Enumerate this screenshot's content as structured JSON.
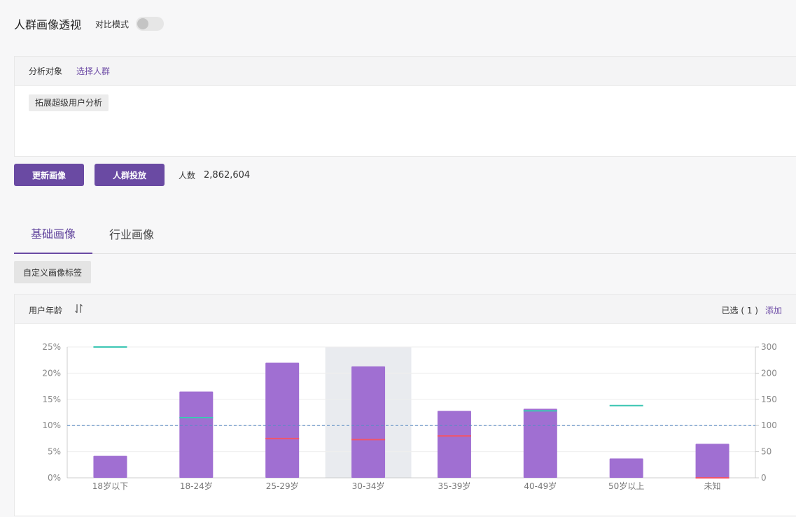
{
  "header": {
    "title": "人群画像透视",
    "compare_mode_label": "对比模式"
  },
  "target": {
    "label": "分析对象",
    "select_link": "选择人群",
    "selected_tag": "拓展超级用户分析"
  },
  "actions": {
    "update_label": "更新画像",
    "deliver_label": "人群投放",
    "count_label": "人数",
    "count_value": "2,862,604"
  },
  "tabs": [
    {
      "label": "基础画像",
      "active": true
    },
    {
      "label": "行业画像",
      "active": false
    }
  ],
  "custom_tags_label": "自定义画像标签",
  "panel": {
    "attribute_label": "用户年龄",
    "selected_label": "已选 ( 1 )",
    "add_label": "添加"
  },
  "colors": {
    "accent": "#6a4aa3",
    "bar": "#a06fd2",
    "tgi_line": "#3cc6b3",
    "compare_line": "#f0546a",
    "reference_line": "#5b8cc4",
    "highlight": "#e9ebef"
  },
  "chart_data": {
    "type": "bar",
    "categories": [
      "18岁以下",
      "18-24岁",
      "25-29岁",
      "30-34岁",
      "35-39岁",
      "40-49岁",
      "50岁以上",
      "未知"
    ],
    "series": [
      {
        "values": [
          4.2,
          16.5,
          22.0,
          21.3,
          12.8,
          13.2,
          3.7,
          6.5
        ],
        "axis": "left"
      },
      {
        "values": [
          300,
          115,
          null,
          null,
          null,
          128,
          138,
          null
        ],
        "axis": "right",
        "style": "marker-teal"
      },
      {
        "values": [
          null,
          null,
          75,
          73,
          80,
          null,
          null,
          0
        ],
        "axis": "right",
        "style": "marker-red"
      }
    ],
    "reference_line": {
      "value": 100,
      "axis": "right",
      "style": "dashed"
    },
    "y_left": {
      "ticks": [
        "0%",
        "5%",
        "10%",
        "15%",
        "20%",
        "25%"
      ],
      "ylim": [
        0,
        25
      ]
    },
    "y_right": {
      "ticks": [
        "0",
        "50",
        "100",
        "150",
        "200",
        "300"
      ],
      "ylim": [
        0,
        300
      ]
    },
    "highlighted_category": "30-34岁",
    "grid": true
  }
}
